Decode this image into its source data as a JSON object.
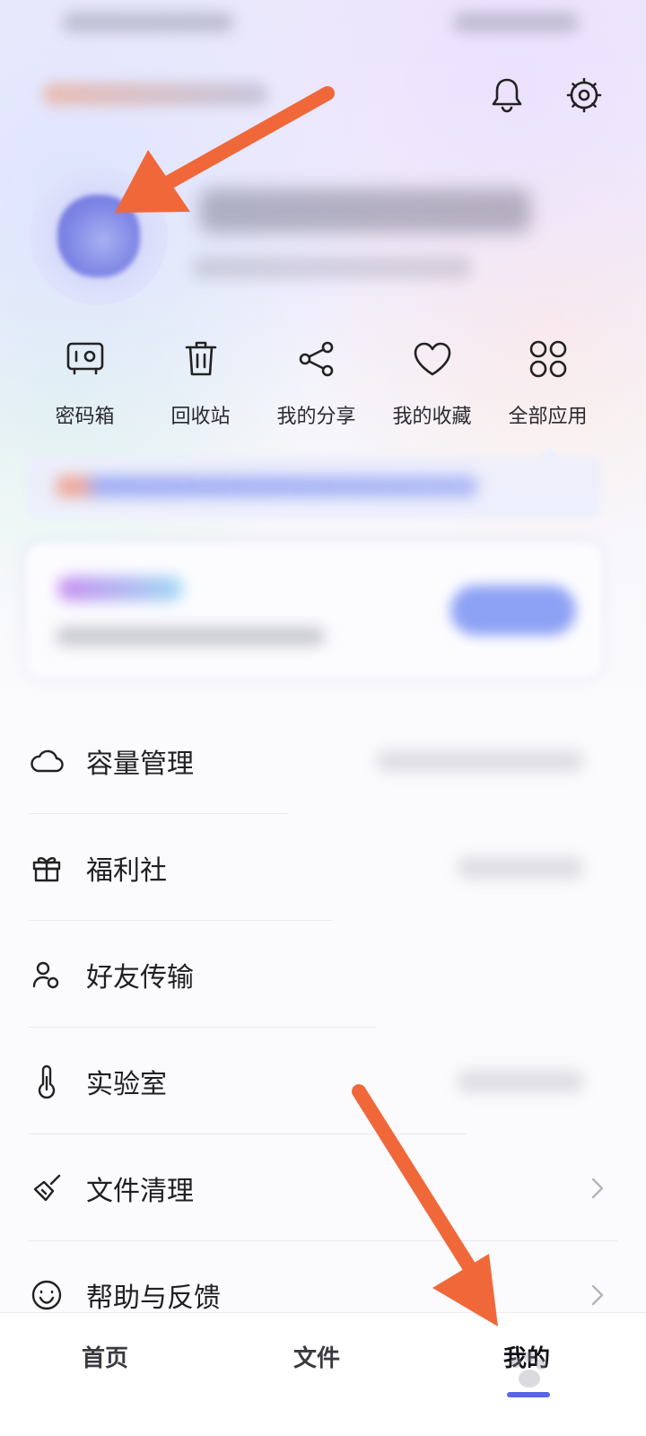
{
  "quick_actions": [
    {
      "label": "密码箱",
      "icon": "safe-box-icon"
    },
    {
      "label": "回收站",
      "icon": "trash-icon"
    },
    {
      "label": "我的分享",
      "icon": "share-icon"
    },
    {
      "label": "我的收藏",
      "icon": "heart-icon"
    },
    {
      "label": "全部应用",
      "icon": "apps-grid-icon"
    }
  ],
  "menu": [
    {
      "label": "容量管理",
      "icon": "cloud-icon"
    },
    {
      "label": "福利社",
      "icon": "gift-icon"
    },
    {
      "label": "好友传输",
      "icon": "friend-transfer-icon"
    },
    {
      "label": "实验室",
      "icon": "thermometer-icon"
    },
    {
      "label": "文件清理",
      "icon": "broom-icon"
    },
    {
      "label": "帮助与反馈",
      "icon": "smiley-icon"
    }
  ],
  "tabs": [
    {
      "label": "首页"
    },
    {
      "label": "文件"
    },
    {
      "label": "我的",
      "active": true
    }
  ],
  "colors": {
    "accent": "#5a64e8",
    "annotation_arrow": "#f0683a"
  }
}
